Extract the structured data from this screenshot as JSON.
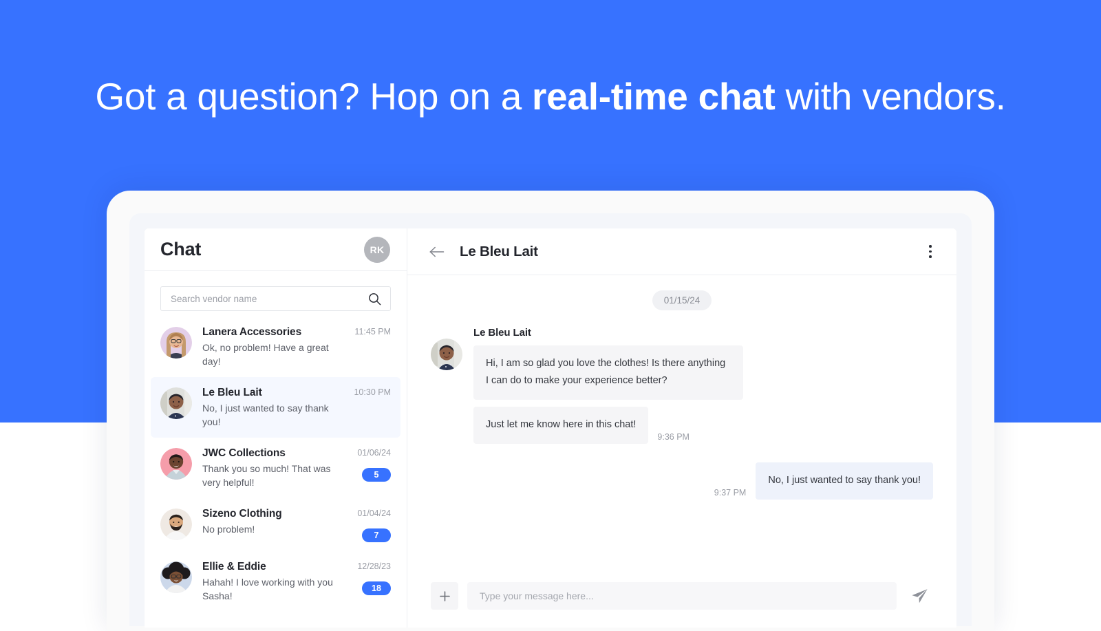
{
  "hero": {
    "headline_part1": "Got a question? Hop on a ",
    "headline_strong": "real-time chat",
    "headline_part2": " with vendors.",
    "background_color": "#3772ff"
  },
  "sidebar": {
    "title": "Chat",
    "user_initials": "RK",
    "search": {
      "placeholder": "Search vendor name",
      "value": ""
    },
    "conversations": [
      {
        "name": "Lanera Accessories",
        "preview": "Ok, no problem! Have a great day!",
        "time": "11:45 PM",
        "badge": "",
        "active": false,
        "avatar_bg": "#e3cfe8"
      },
      {
        "name": "Le Bleu Lait",
        "preview": "No, I just wanted to say thank you!",
        "time": "10:30 PM",
        "badge": "",
        "active": true,
        "avatar_bg": "#dfe0dc"
      },
      {
        "name": "JWC Collections",
        "preview": "Thank you so much! That was very helpful!",
        "time": "01/06/24",
        "badge": "5",
        "active": false,
        "avatar_bg": "#f59daa"
      },
      {
        "name": "Sizeno Clothing",
        "preview": "No problem!",
        "time": "01/04/24",
        "badge": "7",
        "active": false,
        "avatar_bg": "#efe9e3"
      },
      {
        "name": "Ellie & Eddie",
        "preview": "Hahah! I love working with you Sasha!",
        "time": "12/28/23",
        "badge": "18",
        "active": false,
        "avatar_bg": "#ccd8ea"
      }
    ]
  },
  "chat": {
    "header_title": "Le Bleu Lait",
    "date_divider": "01/15/24",
    "sender_name": "Le Bleu Lait",
    "messages": [
      {
        "direction": "in",
        "text": "Hi, I am so glad you love the clothes! Is there anything I can do to make your experience better?",
        "time": ""
      },
      {
        "direction": "in",
        "text": "Just let me know here in this chat!",
        "time": "9:36  PM"
      },
      {
        "direction": "out",
        "text": "No, I just wanted to say thank you!",
        "time": "9:37  PM"
      }
    ],
    "composer": {
      "attach_label": "+",
      "placeholder": "Type your message here...",
      "value": ""
    }
  },
  "icons": {
    "search": "search-icon",
    "back": "back-arrow-icon",
    "kebab": "more-vertical-icon",
    "send": "send-icon",
    "attach": "plus-icon"
  },
  "colors": {
    "brand_blue": "#3772ff",
    "badge_blue": "#3772ff",
    "bubble_in": "#f5f5f7",
    "bubble_out": "#eef2fb",
    "active_item": "#f5f8ff"
  }
}
